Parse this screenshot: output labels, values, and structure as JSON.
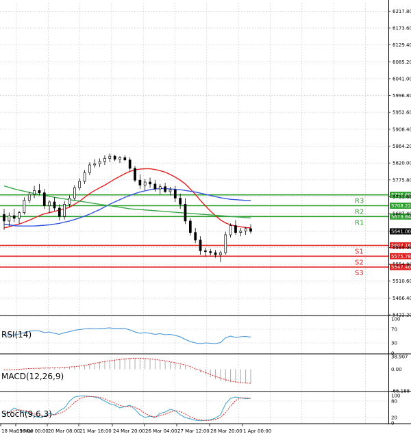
{
  "chart_data": {
    "type": "candlestick",
    "main": {
      "y_ticks": [
        "6217.80",
        "6173.60",
        "6129.40",
        "6085.20",
        "6041.00",
        "5996.80",
        "5952.60",
        "5908.40",
        "5864.20",
        "5820.00",
        "5775.80",
        "5731.60",
        "5687.40",
        "5641.00",
        "5599.00",
        "5554.80",
        "5510.60",
        "5466.40",
        "5422.20"
      ],
      "ylim": [
        5422.2,
        6239.9
      ],
      "current_price": "5641.00",
      "resistance": [
        {
          "label": "R1",
          "value": 5679.84,
          "tag": "5679.84"
        },
        {
          "label": "R2",
          "value": 5708.22,
          "tag": "5708.22"
        },
        {
          "label": "R3",
          "value": 5736.6,
          "tag": "5736.60"
        }
      ],
      "support": [
        {
          "label": "S1",
          "value": 5604.16,
          "tag": "5604.16"
        },
        {
          "label": "S2",
          "value": 5575.78,
          "tag": "5575.78"
        },
        {
          "label": "S3",
          "value": 5547.4,
          "tag": "5547.40"
        }
      ],
      "candles": [
        [
          5685,
          5700,
          5645,
          5668
        ],
        [
          5668,
          5690,
          5655,
          5682
        ],
        [
          5682,
          5700,
          5665,
          5675
        ],
        [
          5675,
          5695,
          5660,
          5690
        ],
        [
          5690,
          5730,
          5685,
          5722
        ],
        [
          5722,
          5745,
          5715,
          5738
        ],
        [
          5738,
          5760,
          5728,
          5748
        ],
        [
          5748,
          5765,
          5735,
          5742
        ],
        [
          5742,
          5752,
          5700,
          5708
        ],
        [
          5708,
          5722,
          5690,
          5718
        ],
        [
          5718,
          5730,
          5695,
          5702
        ],
        [
          5702,
          5712,
          5670,
          5680
        ],
        [
          5680,
          5720,
          5672,
          5712
        ],
        [
          5712,
          5735,
          5705,
          5728
        ],
        [
          5728,
          5762,
          5722,
          5755
        ],
        [
          5755,
          5780,
          5748,
          5772
        ],
        [
          5772,
          5802,
          5765,
          5795
        ],
        [
          5795,
          5822,
          5788,
          5815
        ],
        [
          5815,
          5830,
          5808,
          5818
        ],
        [
          5818,
          5832,
          5810,
          5824
        ],
        [
          5824,
          5840,
          5815,
          5832
        ],
        [
          5832,
          5845,
          5822,
          5838
        ],
        [
          5838,
          5842,
          5825,
          5830
        ],
        [
          5830,
          5838,
          5820,
          5834
        ],
        [
          5834,
          5840,
          5825,
          5828
        ],
        [
          5828,
          5835,
          5800,
          5806
        ],
        [
          5806,
          5812,
          5770,
          5775
        ],
        [
          5775,
          5790,
          5752,
          5762
        ],
        [
          5762,
          5778,
          5748,
          5770
        ],
        [
          5770,
          5782,
          5755,
          5765
        ],
        [
          5765,
          5775,
          5745,
          5752
        ],
        [
          5752,
          5765,
          5738,
          5758
        ],
        [
          5758,
          5768,
          5742,
          5745
        ],
        [
          5745,
          5758,
          5735,
          5750
        ],
        [
          5750,
          5760,
          5718,
          5728
        ],
        [
          5728,
          5740,
          5700,
          5712
        ],
        [
          5712,
          5728,
          5660,
          5668
        ],
        [
          5668,
          5675,
          5630,
          5638
        ],
        [
          5638,
          5650,
          5610,
          5618
        ],
        [
          5618,
          5628,
          5580,
          5590
        ],
        [
          5590,
          5598,
          5575,
          5588
        ],
        [
          5588,
          5595,
          5578,
          5585
        ],
        [
          5585,
          5592,
          5572,
          5580
        ],
        [
          5580,
          5590,
          5560,
          5585
        ],
        [
          5585,
          5640,
          5580,
          5632
        ],
        [
          5632,
          5662,
          5625,
          5656
        ],
        [
          5656,
          5670,
          5632,
          5638
        ],
        [
          5638,
          5650,
          5628,
          5642
        ],
        [
          5642,
          5652,
          5632,
          5648
        ],
        [
          5648,
          5660,
          5635,
          5641
        ]
      ],
      "ma_series": [
        {
          "color": "#e01f1f",
          "values": [
            5650,
            5653,
            5657,
            5660,
            5665,
            5670,
            5676,
            5682,
            5687,
            5690,
            5693,
            5697,
            5700,
            5704,
            5712,
            5720,
            5730,
            5740,
            5748,
            5755,
            5762,
            5770,
            5778,
            5785,
            5792,
            5798,
            5802,
            5804,
            5805,
            5805,
            5803,
            5800,
            5796,
            5790,
            5783,
            5775,
            5765,
            5752,
            5738,
            5722,
            5708,
            5694,
            5682,
            5671,
            5663,
            5658,
            5655,
            5653,
            5651,
            5650
          ]
        },
        {
          "color": "#3355dd",
          "values": [
            5660,
            5658,
            5656,
            5655,
            5655,
            5655,
            5655,
            5656,
            5657,
            5658,
            5660,
            5662,
            5665,
            5668,
            5672,
            5676,
            5681,
            5686,
            5692,
            5698,
            5705,
            5712,
            5718,
            5724,
            5730,
            5735,
            5740,
            5744,
            5747,
            5750,
            5752,
            5753,
            5753,
            5752,
            5751,
            5750,
            5748,
            5746,
            5744,
            5741,
            5738,
            5735,
            5732,
            5729,
            5727,
            5725,
            5724,
            5723,
            5722,
            5722
          ]
        },
        {
          "color": "#3aa64a",
          "values": [
            5760,
            5756,
            5752,
            5749,
            5746,
            5743,
            5740,
            5738,
            5735,
            5733,
            5730,
            5728,
            5726,
            5724,
            5722,
            5720,
            5718,
            5716,
            5714,
            5712,
            5710,
            5708,
            5706,
            5704,
            5702,
            5700,
            5699,
            5698,
            5697,
            5696,
            5695,
            5694,
            5693,
            5692,
            5691,
            5690,
            5689,
            5688,
            5687,
            5686,
            5685,
            5684,
            5683,
            5682,
            5681,
            5680,
            5679,
            5678,
            5677,
            5676
          ]
        }
      ]
    },
    "x_ticks": [
      "18 Mar 16:00",
      "19 Mar 00:00",
      "20 Mar 08:00",
      "21 Mar 16:00",
      "24 Mar 20:00",
      "26 Mar 04:00",
      "27 Mar 12:00",
      "28 Mar 20:00",
      "1 Apr 00:00"
    ],
    "rsi": {
      "label": "RSI(14)",
      "y_ticks": [
        "100",
        "70",
        "30",
        "0"
      ],
      "ylim": [
        0,
        100
      ],
      "levels": [
        70,
        30
      ],
      "values": [
        52,
        54,
        53,
        56,
        60,
        64,
        66,
        65,
        60,
        62,
        58,
        55,
        60,
        63,
        67,
        69,
        71,
        72,
        71,
        72,
        73,
        74,
        72,
        73,
        72,
        68,
        62,
        58,
        60,
        58,
        55,
        57,
        54,
        55,
        52,
        48,
        40,
        34,
        30,
        28,
        30,
        29,
        28,
        31,
        45,
        50,
        46,
        48,
        49,
        47
      ]
    },
    "macd": {
      "label": "MACD(12,26,9)",
      "y_ticks": [
        "38.907",
        "0.00",
        "-66.188"
      ],
      "ylim": [
        -66.188,
        38.907
      ],
      "hist": [
        -3,
        -2,
        -2,
        -1,
        1,
        2,
        3,
        4,
        4,
        5,
        5,
        5,
        6,
        7,
        9,
        11,
        14,
        17,
        20,
        23,
        26,
        28,
        30,
        32,
        34,
        35,
        35,
        34,
        33,
        31,
        29,
        27,
        25,
        22,
        19,
        15,
        10,
        4,
        -3,
        -10,
        -17,
        -24,
        -30,
        -35,
        -38,
        -40,
        -42,
        -43,
        -44,
        -44
      ],
      "signal": [
        -2,
        -2,
        -1,
        0,
        1,
        2,
        3,
        3,
        4,
        4,
        5,
        5,
        6,
        7,
        8,
        10,
        12,
        15,
        18,
        21,
        24,
        26,
        28,
        30,
        32,
        33,
        34,
        34,
        33,
        32,
        30,
        28,
        26,
        23,
        20,
        17,
        13,
        8,
        2,
        -4,
        -10,
        -16,
        -22,
        -27,
        -32,
        -36,
        -39,
        -41,
        -42,
        -43
      ]
    },
    "stoch": {
      "label": "Stoch(9,6,3)",
      "y_ticks": [
        "100",
        "80",
        "20",
        "0"
      ],
      "ylim": [
        0,
        100
      ],
      "levels": [
        80,
        20
      ],
      "k": [
        30,
        40,
        55,
        45,
        40,
        35,
        25,
        20,
        25,
        35,
        30,
        45,
        55,
        80,
        95,
        98,
        99,
        97,
        95,
        90,
        80,
        70,
        65,
        55,
        60,
        65,
        50,
        30,
        20,
        25,
        20,
        35,
        40,
        50,
        45,
        30,
        20,
        15,
        10,
        8,
        10,
        12,
        18,
        30,
        70,
        90,
        95,
        92,
        88,
        90
      ],
      "d": [
        35,
        38,
        45,
        48,
        45,
        40,
        33,
        27,
        24,
        28,
        30,
        35,
        43,
        58,
        75,
        88,
        95,
        97,
        96,
        94,
        88,
        80,
        72,
        64,
        60,
        60,
        58,
        48,
        35,
        26,
        22,
        27,
        32,
        40,
        45,
        42,
        33,
        22,
        15,
        11,
        9,
        10,
        13,
        20,
        38,
        62,
        82,
        92,
        92,
        90
      ]
    }
  }
}
